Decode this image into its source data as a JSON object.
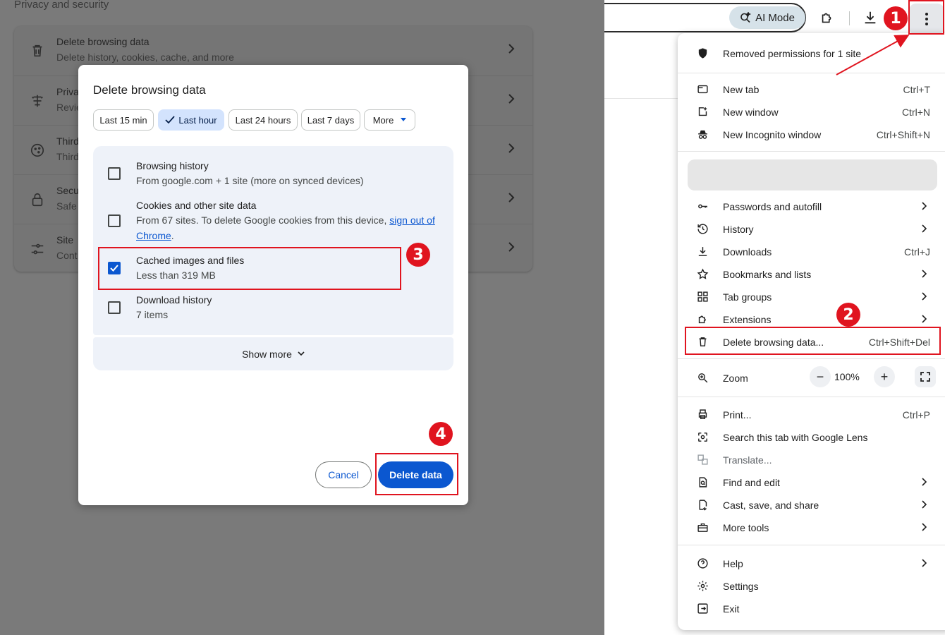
{
  "settings": {
    "section_heading": "Privacy and security",
    "rows": [
      {
        "icon": "trash-icon",
        "title": "Delete browsing data",
        "subtitle": "Delete history, cookies, cache, and more"
      },
      {
        "icon": "privacy-guide-icon",
        "title": "Priva",
        "subtitle": "Revie"
      },
      {
        "icon": "cookie-icon",
        "title": "Third",
        "subtitle": "Third"
      },
      {
        "icon": "lock-icon",
        "title": "Secu",
        "subtitle": "Safe"
      },
      {
        "icon": "sliders-icon",
        "title": "Site",
        "subtitle": "Cont"
      }
    ]
  },
  "dialog": {
    "title": "Delete browsing data",
    "time_ranges": [
      "Last 15 min",
      "Last hour",
      "Last 24 hours",
      "Last 7 days",
      "More"
    ],
    "selected_range": "Last hour",
    "options": [
      {
        "title": "Browsing history",
        "subtitle": "From google.com + 1 site (more on synced devices)",
        "checked": false
      },
      {
        "title": "Cookies and other site data",
        "subtitle_prefix": "From 67 sites. To delete Google cookies from this device,",
        "subtitle_link_1": "sign out of",
        "subtitle_link_2": "Chrome",
        "subtitle_suffix": ".",
        "checked": false
      },
      {
        "title": "Cached images and files",
        "subtitle": "Less than 319 MB",
        "checked": true
      },
      {
        "title": "Download history",
        "subtitle": "7 items",
        "checked": false
      }
    ],
    "show_more": "Show more",
    "cancel": "Cancel",
    "delete": "Delete data"
  },
  "toolbar": {
    "ai_mode": "AI Mode"
  },
  "menu": {
    "permissions_notice": "Removed permissions for 1 site",
    "items": {
      "new_tab": {
        "label": "New tab",
        "shortcut": "Ctrl+T"
      },
      "new_window": {
        "label": "New window",
        "shortcut": "Ctrl+N"
      },
      "incognito": {
        "label": "New Incognito window",
        "shortcut": "Ctrl+Shift+N"
      },
      "passwords": {
        "label": "Passwords and autofill"
      },
      "history": {
        "label": "History"
      },
      "downloads": {
        "label": "Downloads",
        "shortcut": "Ctrl+J"
      },
      "bookmarks": {
        "label": "Bookmarks and lists"
      },
      "tab_groups": {
        "label": "Tab groups"
      },
      "extensions": {
        "label": "Extensions"
      },
      "delete_data": {
        "label": "Delete browsing data...",
        "shortcut": "Ctrl+Shift+Del"
      },
      "zoom": {
        "label": "Zoom",
        "value": "100%",
        "minus": "−",
        "plus": "+"
      },
      "print": {
        "label": "Print...",
        "shortcut": "Ctrl+P"
      },
      "lens": {
        "label": "Search this tab with Google Lens"
      },
      "translate": {
        "label": "Translate..."
      },
      "find_edit": {
        "label": "Find and edit"
      },
      "cast": {
        "label": "Cast, save, and share"
      },
      "more_tools": {
        "label": "More tools"
      },
      "help": {
        "label": "Help"
      },
      "settings": {
        "label": "Settings"
      },
      "exit": {
        "label": "Exit"
      }
    }
  },
  "annotations": {
    "step1": "1",
    "step2": "2",
    "step3": "3",
    "step4": "4",
    "color": "#e0141f"
  },
  "colors": {
    "accent": "#0b57d0",
    "chip_selected": "#d3e3fd",
    "option_bg": "#eef2f9",
    "overlay": "#7a7a7a"
  }
}
